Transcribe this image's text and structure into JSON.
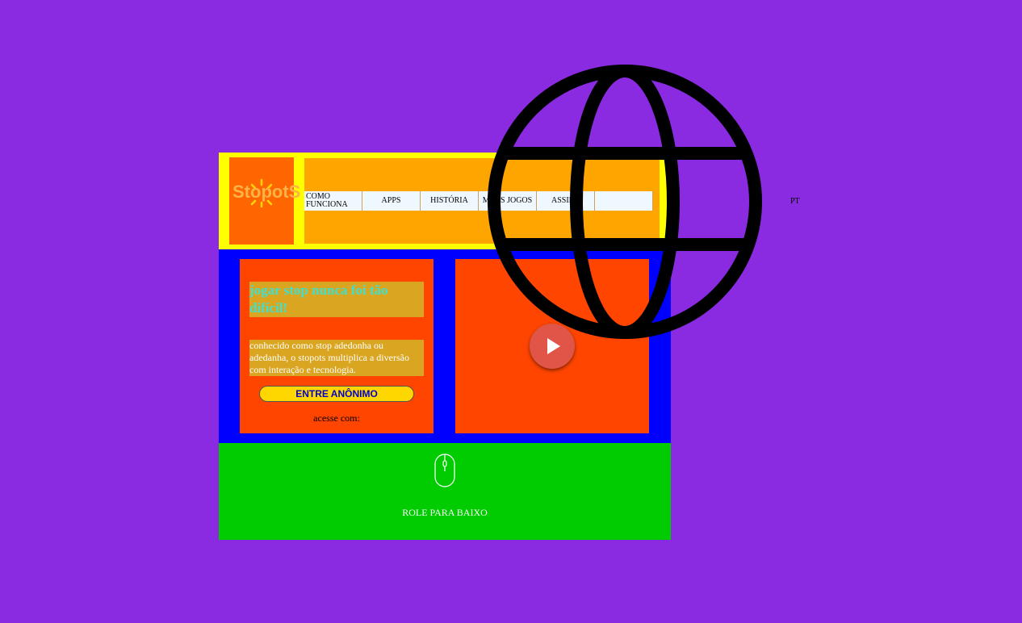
{
  "header": {
    "logo_text": "StopotS",
    "nav": [
      "COMO FUNCIONA",
      "APPS",
      "HISTÓRIA",
      "MEUS JOGOS",
      "ASSINE",
      ""
    ],
    "lang": "PT"
  },
  "hero": {
    "headline": "jogar stop nunca foi tão difícil!",
    "description": "conhecido como stop adedonha ou adedanha, o stopots multiplica a diversão com interação e tecnologia.",
    "cta_label": "ENTRE ANÔNIMO",
    "access_label": "acesse com:"
  },
  "scroll": {
    "label": "ROLE PARA BAIXO"
  },
  "colors": {
    "background": "#8a2be2",
    "header": "#ffff00",
    "logo_box": "#ff6600",
    "nav_area": "#ffa500",
    "hero": "#0000ff",
    "card": "#ff4500",
    "text_block": "#daa520",
    "cta": "#ffd700",
    "scroll": "#00cc00"
  },
  "icons": [
    "globe-icon",
    "play-icon",
    "mouse-icon"
  ]
}
